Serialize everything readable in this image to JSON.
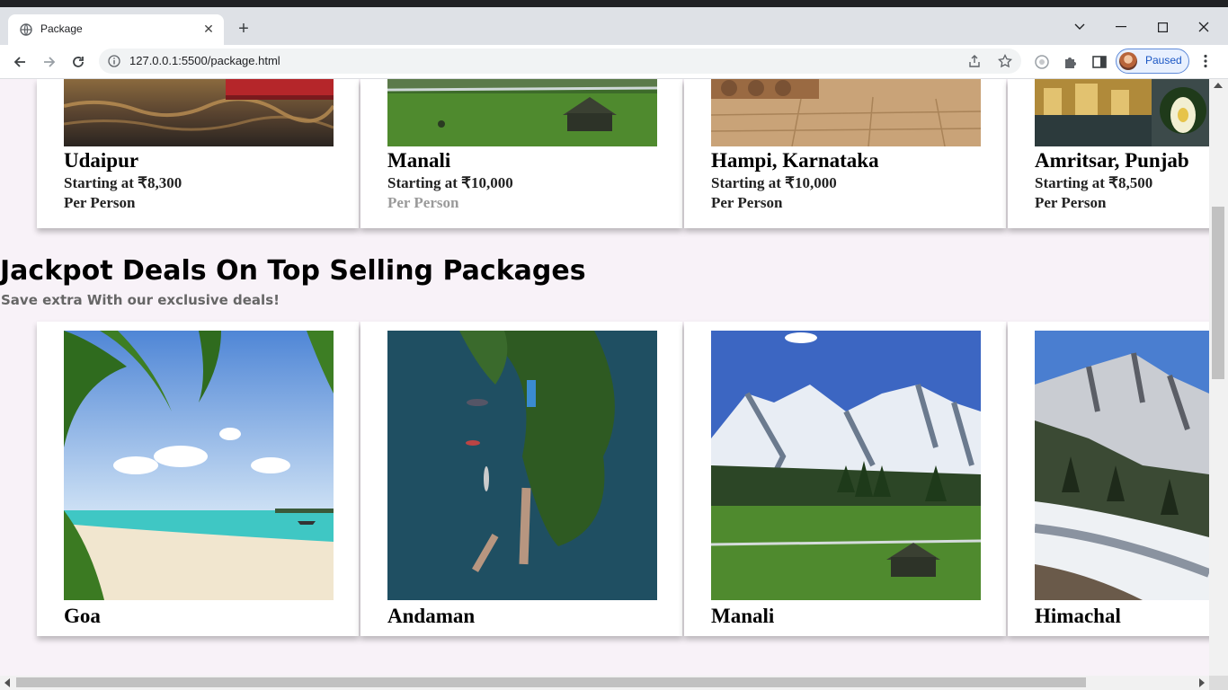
{
  "browser": {
    "tab_title": "Package",
    "url": "127.0.0.1:5500/package.html",
    "profile_label": "Paused",
    "icons": [
      "globe-icon",
      "close-icon",
      "plus-icon",
      "back-icon",
      "forward-icon",
      "reload-icon",
      "info-icon",
      "share-icon",
      "star-icon",
      "extension-icon",
      "puzzle-icon",
      "sidebar-icon",
      "menu-icon",
      "minimize-icon",
      "maximize-icon",
      "close-window-icon",
      "chevron-down-icon"
    ]
  },
  "top_packages": [
    {
      "name": "Udaipur",
      "price": "Starting at ₹8,300",
      "per": "Per Person"
    },
    {
      "name": "Manali",
      "price": "Starting at ₹10,000",
      "per": "Per Person"
    },
    {
      "name": "Hampi, Karnataka",
      "price": "Starting at ₹10,000",
      "per": "Per Person"
    },
    {
      "name": "Amritsar, Punjab",
      "price": "Starting at ₹8,500",
      "per": "Per Person"
    }
  ],
  "deals": {
    "heading": "Jackpot Deals On Top Selling Packages",
    "subheading": "Save extra With our exclusive deals!",
    "cards": [
      {
        "name": "Goa"
      },
      {
        "name": "Andaman"
      },
      {
        "name": "Manali"
      },
      {
        "name": "Himachal"
      }
    ]
  },
  "colors": {
    "page_bg": "#f8f2f8",
    "accent": "#1a73e8"
  }
}
